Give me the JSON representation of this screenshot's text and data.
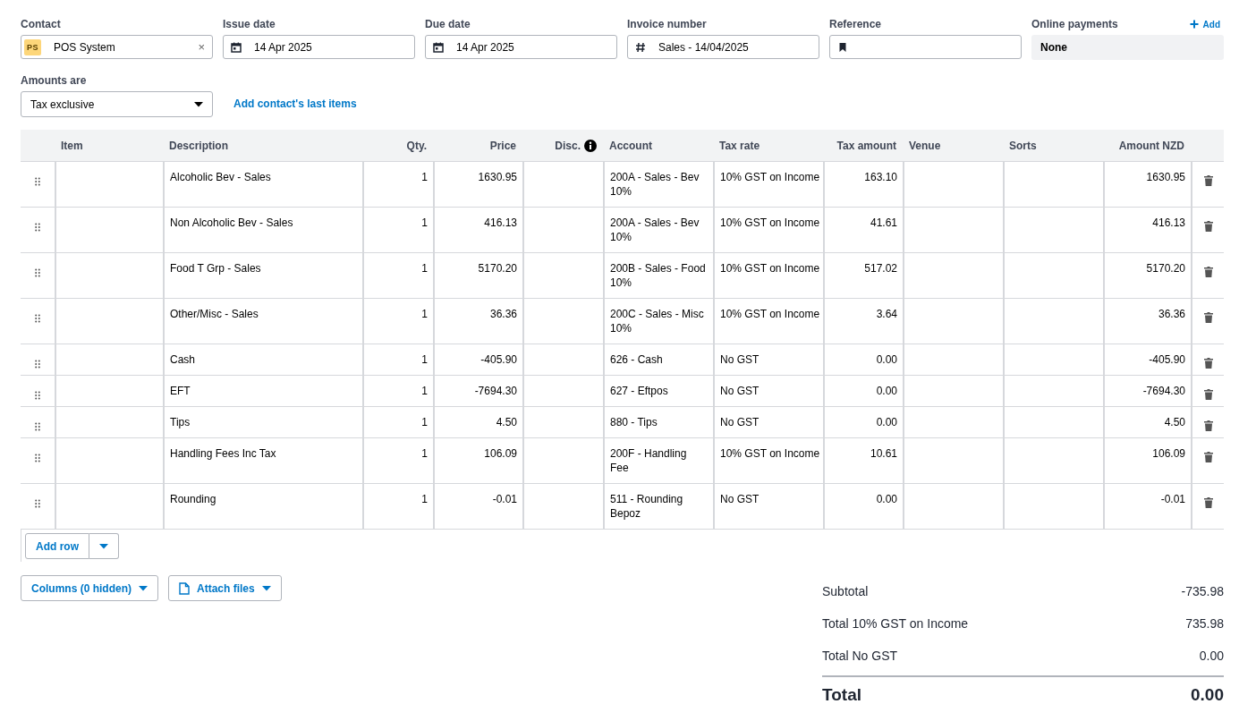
{
  "fields": [
    {
      "label": "Contact",
      "kind": "contact",
      "avatar": "PS",
      "value": "POS System",
      "clear": "×"
    },
    {
      "label": "Issue date",
      "kind": "date",
      "value": "14 Apr 2025"
    },
    {
      "label": "Due date",
      "kind": "date",
      "value": "14 Apr 2025"
    },
    {
      "label": "Invoice number",
      "kind": "number",
      "value": "Sales - 14/04/2025"
    },
    {
      "label": "Reference",
      "kind": "reference"
    }
  ],
  "online_payments": {
    "label": "Online payments",
    "add": "Add",
    "value": "None"
  },
  "amounts_are": {
    "label": "Amounts are",
    "value": "Tax exclusive"
  },
  "add_last_items": "Add contact's last items",
  "table": {
    "columns": [
      "Item",
      "Description",
      "Qty.",
      "Price",
      "Disc.",
      "Account",
      "Tax rate",
      "Tax amount",
      "Venue",
      "Sorts",
      "Amount NZD"
    ],
    "rows": [
      {
        "description": "Alcoholic Bev - Sales",
        "qty": "1",
        "price": "1630.95",
        "account": "200A - Sales - Bev 10%",
        "tax_rate": "10% GST on Income",
        "tax_amount": "163.10",
        "amount": "1630.95"
      },
      {
        "description": "Non Alcoholic Bev - Sales",
        "qty": "1",
        "price": "416.13",
        "account": "200A - Sales - Bev 10%",
        "tax_rate": "10% GST on Income",
        "tax_amount": "41.61",
        "amount": "416.13"
      },
      {
        "description": "Food T Grp - Sales",
        "qty": "1",
        "price": "5170.20",
        "account": "200B - Sales - Food 10%",
        "tax_rate": "10% GST on Income",
        "tax_amount": "517.02",
        "amount": "5170.20"
      },
      {
        "description": "Other/Misc - Sales",
        "qty": "1",
        "price": "36.36",
        "account": "200C - Sales - Misc 10%",
        "tax_rate": "10% GST on Income",
        "tax_amount": "3.64",
        "amount": "36.36"
      },
      {
        "description": "Cash",
        "qty": "1",
        "price": "-405.90",
        "account": "626 - Cash",
        "tax_rate": "No GST",
        "tax_amount": "0.00",
        "amount": "-405.90"
      },
      {
        "description": "EFT",
        "qty": "1",
        "price": "-7694.30",
        "account": "627 - Eftpos",
        "tax_rate": "No GST",
        "tax_amount": "0.00",
        "amount": "-7694.30"
      },
      {
        "description": "Tips",
        "qty": "1",
        "price": "4.50",
        "account": "880 - Tips",
        "tax_rate": "No GST",
        "tax_amount": "0.00",
        "amount": "4.50"
      },
      {
        "description": "Handling Fees Inc Tax",
        "qty": "1",
        "price": "106.09",
        "account": "200F - Handling Fee",
        "tax_rate": "10% GST on Income",
        "tax_amount": "10.61",
        "amount": "106.09"
      },
      {
        "description": "Rounding",
        "qty": "1",
        "price": "-0.01",
        "account": "511 - Rounding Bepoz",
        "tax_rate": "No GST",
        "tax_amount": "0.00",
        "amount": "-0.01"
      }
    ]
  },
  "add_row": "Add row",
  "columns_button": "Columns (0 hidden)",
  "attach_button": "Attach files",
  "totals": [
    {
      "label": "Subtotal",
      "value": "-735.98"
    },
    {
      "label": "Total 10% GST on Income",
      "value": "735.98"
    },
    {
      "label": "Total No GST",
      "value": "0.00"
    }
  ],
  "total": {
    "label": "Total",
    "value": "0.00"
  }
}
